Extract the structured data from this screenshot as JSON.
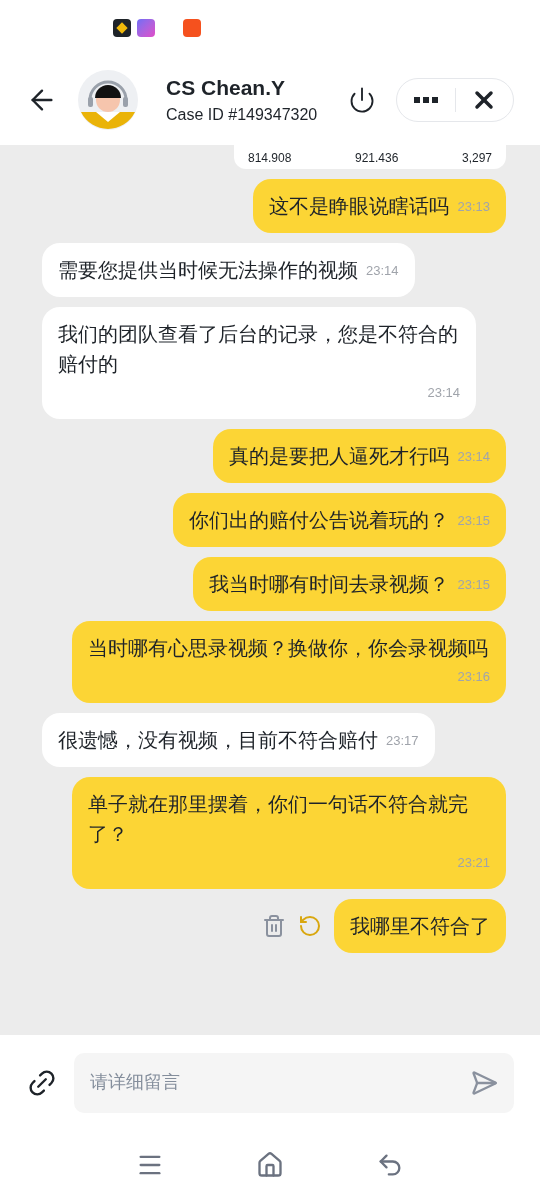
{
  "header": {
    "name": "CS Chean.Y",
    "case_id": "Case ID #149347320"
  },
  "shared_image": {
    "values": [
      "814.908",
      "921.436",
      "3,297"
    ]
  },
  "messages": [
    {
      "kind": "me",
      "text": "这不是睁眼说瞎话吗",
      "time": "23:13",
      "failed": false
    },
    {
      "kind": "agent",
      "text": "需要您提供当时候无法操作的视频",
      "time": "23:14",
      "failed": false
    },
    {
      "kind": "agent",
      "text": "我们的团队查看了后台的记录，您是不符合的赔付的",
      "time": "23:14",
      "failed": false
    },
    {
      "kind": "me",
      "text": "真的是要把人逼死才行吗",
      "time": "23:14",
      "failed": false
    },
    {
      "kind": "me",
      "text": "你们出的赔付公告说着玩的？",
      "time": "23:15",
      "failed": false
    },
    {
      "kind": "me",
      "text": "我当时哪有时间去录视频？",
      "time": "23:15",
      "failed": false
    },
    {
      "kind": "me",
      "text": "当时哪有心思录视频？换做你，你会录视频吗",
      "time": "23:16",
      "failed": false
    },
    {
      "kind": "agent",
      "text": "很遗憾，没有视频，目前不符合赔付",
      "time": "23:17",
      "failed": false
    },
    {
      "kind": "me",
      "text": "单子就在那里摆着，你们一句话不符合就完了？",
      "time": "23:21",
      "failed": false
    },
    {
      "kind": "me",
      "text": "我哪里不符合了",
      "failed": true
    }
  ],
  "composer": {
    "placeholder": "请详细留言"
  }
}
